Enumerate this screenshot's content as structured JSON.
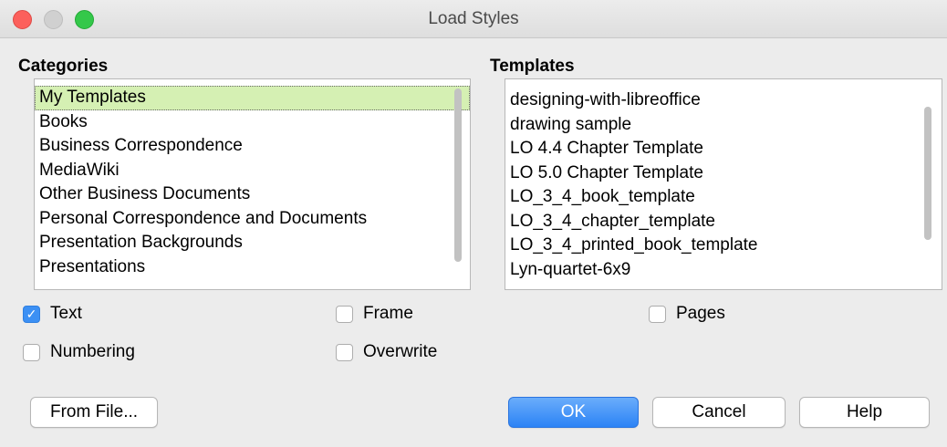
{
  "window": {
    "title": "Load Styles"
  },
  "colors": {
    "accent": "#3c90f4",
    "selection": "#d5f0b3",
    "window_bg": "#ececec"
  },
  "categories": {
    "heading": "Categories",
    "selected_index": 0,
    "items": [
      "My Templates",
      "Books",
      "Business Correspondence",
      "MediaWiki",
      "Other Business Documents",
      "Personal Correspondence and Documents",
      "Presentation Backgrounds",
      "Presentations"
    ]
  },
  "templates": {
    "heading": "Templates",
    "items": [
      "designing-with-libreoffice",
      "drawing sample",
      "LO 4.4 Chapter Template",
      "LO 5.0 Chapter Template",
      "LO_3_4_book_template",
      "LO_3_4_chapter_template",
      "LO_3_4_printed_book_template",
      "Lyn-quartet-6x9"
    ]
  },
  "options": {
    "text": {
      "label": "Text",
      "checked": true
    },
    "frame": {
      "label": "Frame",
      "checked": false
    },
    "pages": {
      "label": "Pages",
      "checked": false
    },
    "numbering": {
      "label": "Numbering",
      "checked": false
    },
    "overwrite": {
      "label": "Overwrite",
      "checked": false
    }
  },
  "buttons": {
    "from_file": "From File...",
    "ok": "OK",
    "cancel": "Cancel",
    "help": "Help"
  }
}
